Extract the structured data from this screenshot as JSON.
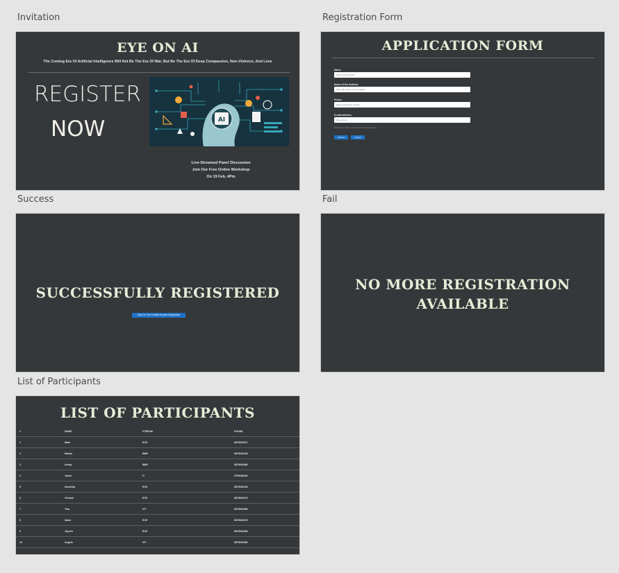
{
  "frames": {
    "invitation": {
      "label": "Invitation",
      "title": "EYE ON AI",
      "subtitle": "The Coming Era Of Artificial Intelligence Will Not Be The Era Of War, But Be The Era Of Deep Compassion, Non-Violence, And Love",
      "register": "REGISTER",
      "now": "NOW",
      "ai_badge": "AI",
      "info_line1": "Live-Streamed Panel Discussion",
      "info_line2": "Join Our Free Online Workshop",
      "info_line3": "On 19 Feb, 4Pm"
    },
    "form": {
      "label": "Registration Form",
      "title": "APPLICATION FORM",
      "fields": [
        {
          "label": "Name",
          "placeholder": "Enter your full name"
        },
        {
          "label": "Name of the Institute",
          "placeholder": "Enter the name of your institute"
        },
        {
          "label": "Phone",
          "placeholder": "Enter your phone number"
        },
        {
          "label": "E-mail address",
          "placeholder": "Enter email"
        }
      ],
      "help": "We'll never share your email with anyone else.",
      "submit": "Submit",
      "cancel": "Cancel"
    },
    "success": {
      "label": "Success",
      "title": "SUCCESSFULLY REGISTERED",
      "button": "Click On This To Make Another Registration"
    },
    "fail": {
      "label": "Fail",
      "title_line1": "NO MORE REGISTRATION",
      "title_line2": "AVAILABLE"
    },
    "participants": {
      "label": "List of Participants",
      "title": "LIST OF PARTICIPANTS",
      "columns": [
        "#",
        "NAME",
        "STREAM",
        "PHONE"
      ],
      "rows": [
        [
          "1",
          "Mark",
          "ECE",
          "8876543211"
        ],
        [
          "2",
          "Mukku",
          "BME",
          "6876543246"
        ],
        [
          "3",
          "Ankay",
          "BME",
          "8876543466"
        ],
        [
          "4",
          "Jimmi",
          "IT",
          "9765436445"
        ],
        [
          "5",
          "Avashika",
          "ECE",
          "6876543445"
        ],
        [
          "6",
          "Chinkal",
          "ECE",
          "6876543475"
        ],
        [
          "7",
          "Tina",
          "VIT",
          "6876543466"
        ],
        [
          "8",
          "Sawn",
          "ECE",
          "6876543476"
        ],
        [
          "9",
          "Jayesh",
          "ECE",
          "6876543456"
        ],
        [
          "10",
          "Angela",
          "VIT",
          "8876543465"
        ]
      ]
    }
  },
  "colors": {
    "frame_bg": "#35383a",
    "stencil_text": "#e4ecd6",
    "button_blue": "#1e73c8",
    "canvas_bg": "#e5e5e5"
  }
}
